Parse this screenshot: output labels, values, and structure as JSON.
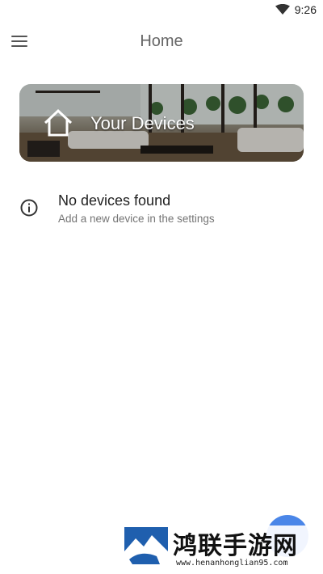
{
  "status_bar": {
    "time": "9:26",
    "wifi_icon": "wifi-icon"
  },
  "app_bar": {
    "title": "Home",
    "menu_icon": "hamburger-menu-icon"
  },
  "banner": {
    "title": "Your Devices",
    "icon": "home-outline-icon"
  },
  "empty_state": {
    "icon": "info-icon",
    "title": "No devices found",
    "subtitle": "Add a new device in the settings"
  },
  "fab": {
    "color": "#4a86e8"
  },
  "watermark": {
    "text": "鸿联手游网",
    "url": "www.henanhonglian95.com"
  }
}
